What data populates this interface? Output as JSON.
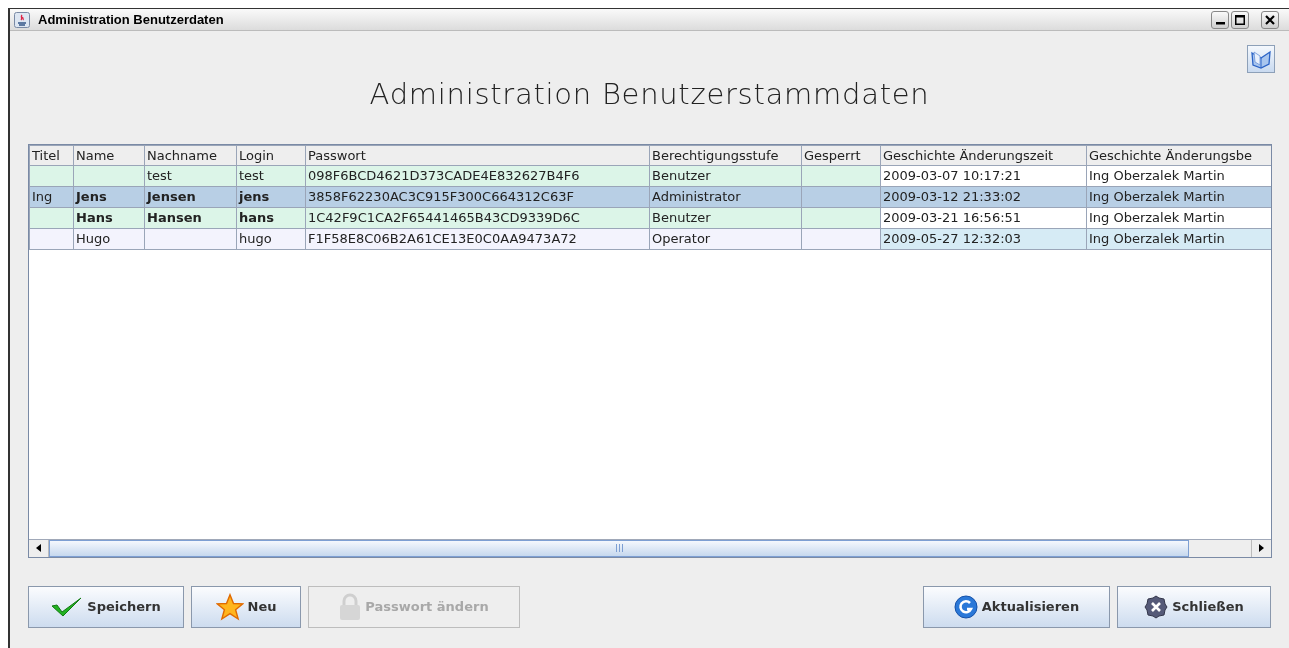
{
  "window": {
    "title": "Administration Benutzerdaten"
  },
  "heading": "Administration Benutzerstammdaten",
  "table": {
    "columns": [
      "Titel",
      "Name",
      "Nachname",
      "Login",
      "Passwort",
      "Berechtigungsstufe",
      "Gesperrt",
      "Geschichte Änderungszeit",
      "Geschichte Änderungsbe"
    ],
    "rows": [
      {
        "cells": [
          "",
          "",
          "test",
          "test",
          "098F6BCD4621D373CADE4E832627B4F6",
          "Benutzer",
          ""
        ],
        "history": {
          "cells": [
            "2009-03-07 10:17:21",
            "Ing Oberzalek Martin"
          ],
          "color": "#ffffff"
        },
        "selected": false,
        "bold": false,
        "color": "#dcf5e8"
      },
      {
        "cells": [
          "Ing",
          "Jens",
          "Jensen",
          "jens",
          "3858F62230AC3C915F300C664312C63F",
          "Administrator",
          ""
        ],
        "history": {
          "cells": [
            "2009-03-12 21:33:02",
            "Ing Oberzalek Martin"
          ]
        },
        "selected": true,
        "bold": true
      },
      {
        "cells": [
          "",
          "Hans",
          "Hansen",
          "hans",
          "1C42F9C1CA2F65441465B43CD9339D6C",
          "Benutzer",
          ""
        ],
        "history": {
          "cells": [
            "2009-03-21 16:56:51",
            "Ing Oberzalek Martin"
          ],
          "color": "#ffffff"
        },
        "selected": false,
        "bold": true,
        "color": "#dcf5e8"
      },
      {
        "cells": [
          "",
          "Hugo",
          "",
          "hugo",
          "F1F58E8C06B2A61CE13E0C0AA9473A72",
          "Operator",
          ""
        ],
        "history": {
          "cells": [
            "2009-05-27 12:32:03",
            "Ing Oberzalek Martin"
          ],
          "color": "#d6ebf5"
        },
        "selected": false,
        "bold": false,
        "color": "#f3f3fd"
      }
    ]
  },
  "buttons": [
    {
      "label": "Speichern",
      "kind": "save",
      "disabled": false
    },
    {
      "label": "Neu",
      "kind": "new",
      "disabled": false
    },
    {
      "label": "Passwort ändern",
      "kind": "password",
      "disabled": true
    },
    {
      "label": "Aktualisieren",
      "kind": "refresh",
      "disabled": false
    },
    {
      "label": "Schließen",
      "kind": "close",
      "disabled": false
    }
  ]
}
